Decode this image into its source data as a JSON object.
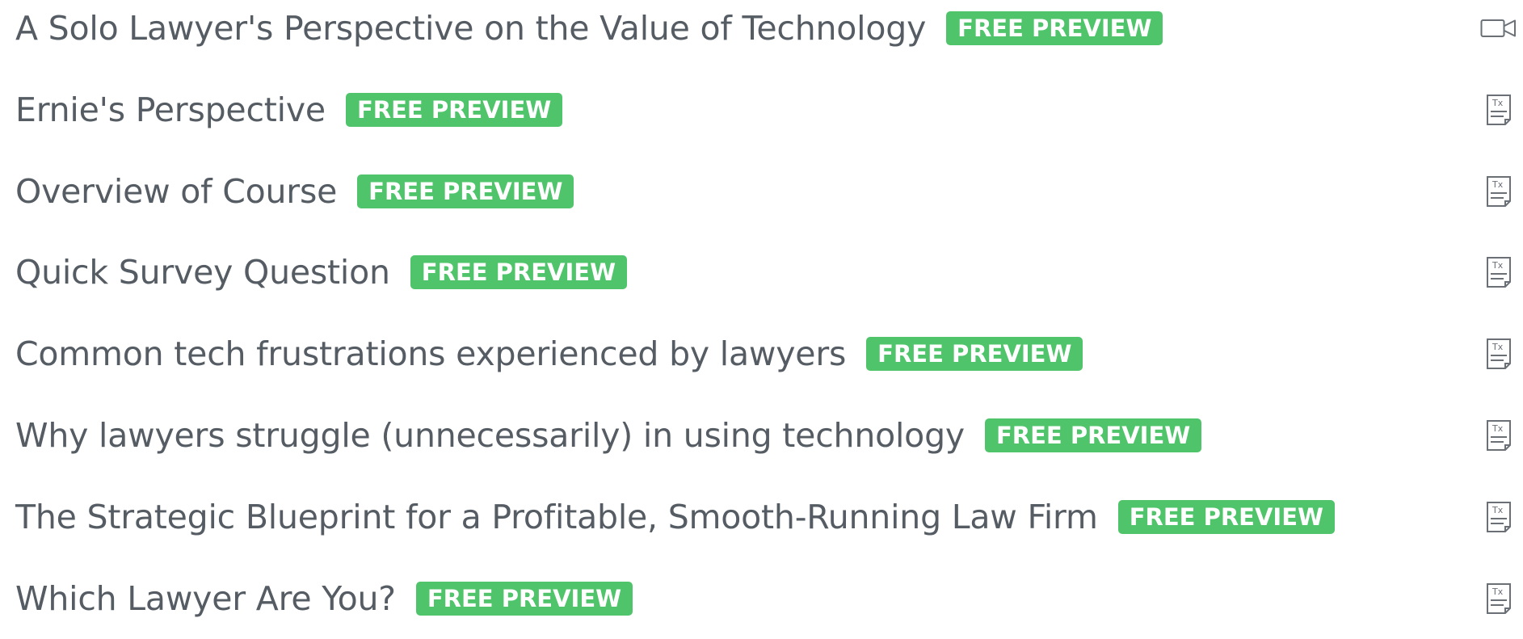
{
  "lessons": [
    {
      "title": "A Solo Lawyer's Perspective on the Value of Technology",
      "badge": "FREE PREVIEW",
      "icon": "video-icon"
    },
    {
      "title": "Ernie's Perspective",
      "badge": "FREE PREVIEW",
      "icon": "text-document-icon"
    },
    {
      "title": "Overview of Course",
      "badge": "FREE PREVIEW",
      "icon": "text-document-icon"
    },
    {
      "title": "Quick Survey Question",
      "badge": "FREE PREVIEW",
      "icon": "text-document-icon"
    },
    {
      "title": "Common tech frustrations experienced by lawyers",
      "badge": "FREE PREVIEW",
      "icon": "text-document-icon"
    },
    {
      "title": "Why lawyers struggle (unnecessarily) in using technology",
      "badge": "FREE PREVIEW",
      "icon": "text-document-icon"
    },
    {
      "title": "The Strategic Blueprint for a Profitable, Smooth-Running Law Firm",
      "badge": "FREE PREVIEW",
      "icon": "text-document-icon"
    },
    {
      "title": "Which Lawyer Are You?",
      "badge": "FREE PREVIEW",
      "icon": "text-document-icon"
    }
  ],
  "colors": {
    "badge_bg": "#4fc46b",
    "title_text": "#555c63",
    "icon_stroke": "#6b7077"
  }
}
